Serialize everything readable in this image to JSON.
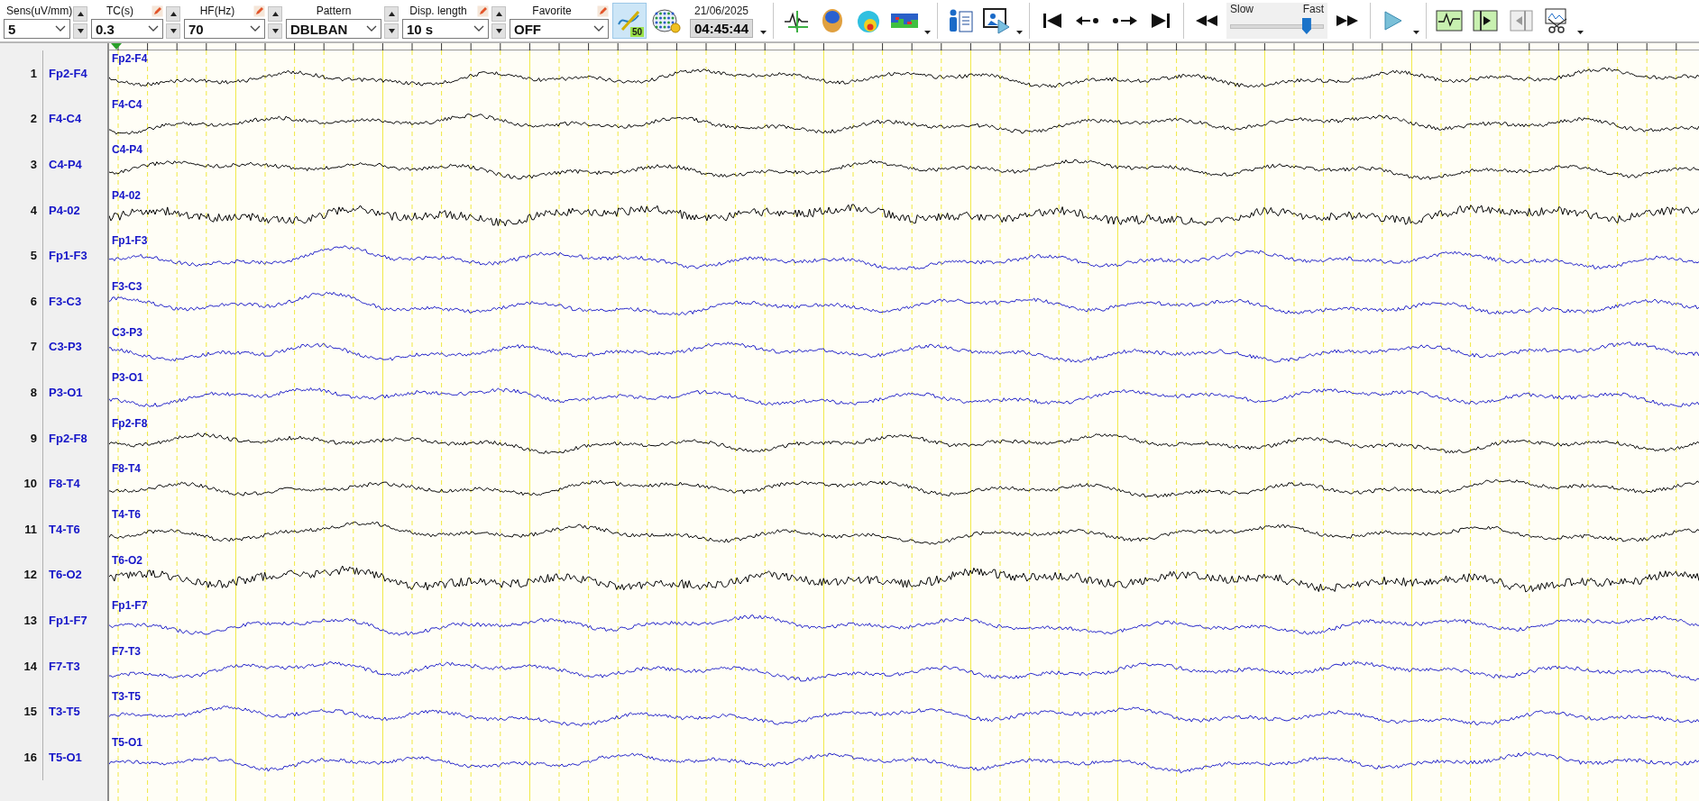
{
  "toolbar": {
    "controls": [
      {
        "label": "Sens(uV/mm)",
        "value": "5",
        "editable": false,
        "spin": true
      },
      {
        "label": "TC(s)",
        "value": "0.3",
        "editable": true,
        "spin": true
      },
      {
        "label": "HF(Hz)",
        "value": "70",
        "editable": true,
        "spin": true
      },
      {
        "label": "Pattern",
        "value": "DBLBAN",
        "editable": false,
        "spin": true
      },
      {
        "label": "Disp. length",
        "value": "10 s",
        "editable": true,
        "spin": true
      },
      {
        "label": "Favorite",
        "value": "OFF",
        "editable": true,
        "spin": false
      }
    ],
    "overlay_toggle": {
      "badge": "50",
      "selected": true
    },
    "date": "21/06/2025",
    "time": "04:45:44",
    "speed": {
      "slow_label": "Slow",
      "fast_label": "Fast",
      "level": 0.85
    }
  },
  "channels": [
    {
      "number": "1",
      "name": "Fp2-F4",
      "trace_label": "Fp2-F4",
      "color": "#000000"
    },
    {
      "number": "2",
      "name": "F4-C4",
      "trace_label": "F4-C4",
      "color": "#000000"
    },
    {
      "number": "3",
      "name": "C4-P4",
      "trace_label": "C4-P4",
      "color": "#000000"
    },
    {
      "number": "4",
      "name": "P4-02",
      "trace_label": "P4-02",
      "color": "#000000"
    },
    {
      "number": "5",
      "name": "Fp1-F3",
      "trace_label": "Fp1-F3",
      "color": "#1c1cc8"
    },
    {
      "number": "6",
      "name": "F3-C3",
      "trace_label": "F3-C3",
      "color": "#1c1cc8"
    },
    {
      "number": "7",
      "name": "C3-P3",
      "trace_label": "C3-P3",
      "color": "#1c1cc8"
    },
    {
      "number": "8",
      "name": "P3-O1",
      "trace_label": "P3-O1",
      "color": "#1c1cc8"
    },
    {
      "number": "9",
      "name": "Fp2-F8",
      "trace_label": "Fp2-F8",
      "color": "#000000"
    },
    {
      "number": "10",
      "name": "F8-T4",
      "trace_label": "F8-T4",
      "color": "#000000"
    },
    {
      "number": "11",
      "name": "T4-T6",
      "trace_label": "T4-T6",
      "color": "#000000"
    },
    {
      "number": "12",
      "name": "T6-O2",
      "trace_label": "T6-O2",
      "color": "#000000"
    },
    {
      "number": "13",
      "name": "Fp1-F7",
      "trace_label": "Fp1-F7",
      "color": "#1c1cc8"
    },
    {
      "number": "14",
      "name": "F7-T3",
      "trace_label": "F7-T3",
      "color": "#1c1cc8"
    },
    {
      "number": "15",
      "name": "T3-T5",
      "trace_label": "T3-T5",
      "color": "#1c1cc8"
    },
    {
      "number": "16",
      "name": "T5-O1",
      "trace_label": "T5-O1",
      "color": "#1c1cc8"
    }
  ]
}
